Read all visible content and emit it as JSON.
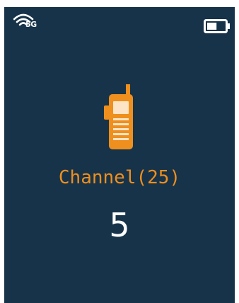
{
  "status_bar": {
    "signal_icon": "wifi-signal-icon",
    "signal_label": "5G",
    "battery_icon": "battery-icon",
    "battery_level": 0.55
  },
  "main": {
    "radio_icon": "walkie-talkie-icon",
    "channel_label": "Channel(25)",
    "channel_number": "5"
  },
  "colors": {
    "background": "#17334a",
    "accent": "#ee8f1e",
    "text": "#ffffff"
  }
}
